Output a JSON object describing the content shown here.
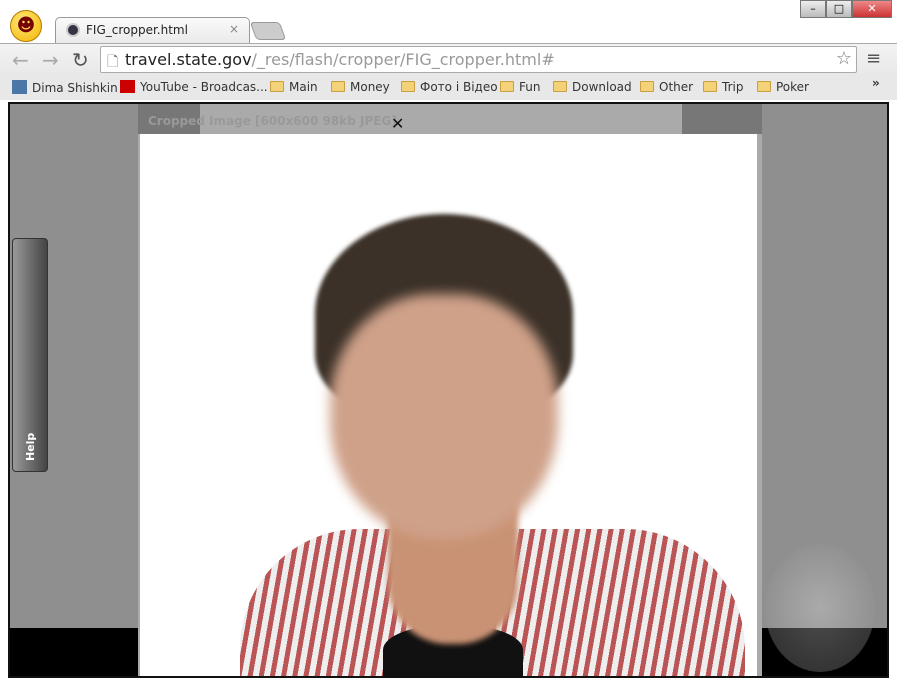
{
  "browser": {
    "tab_title": "FIG_cropper.html",
    "url_host": "travel.state.gov",
    "url_path": "/_res/flash/cropper/FIG_cropper.html#",
    "window_buttons": [
      "–",
      "□",
      "✕"
    ],
    "bookmarks": [
      {
        "label": "Dima Shishkin",
        "icon": "vk-icon"
      },
      {
        "label": "YouTube - Broadcas...",
        "icon": "youtube-icon"
      },
      {
        "label": "Main",
        "icon": "folder-icon"
      },
      {
        "label": "Money",
        "icon": "folder-icon"
      },
      {
        "label": "Фото і Відео",
        "icon": "folder-icon"
      },
      {
        "label": "Fun",
        "icon": "folder-icon"
      },
      {
        "label": "Download",
        "icon": "folder-icon"
      },
      {
        "label": "Other",
        "icon": "folder-icon"
      },
      {
        "label": "Trip",
        "icon": "folder-icon"
      },
      {
        "label": "Poker",
        "icon": "folder-icon"
      }
    ],
    "overflow": "»"
  },
  "dialog": {
    "title": "Cropped Image [600x600 98kb JPEG]",
    "close": "✕"
  },
  "help": {
    "label": "Help"
  }
}
